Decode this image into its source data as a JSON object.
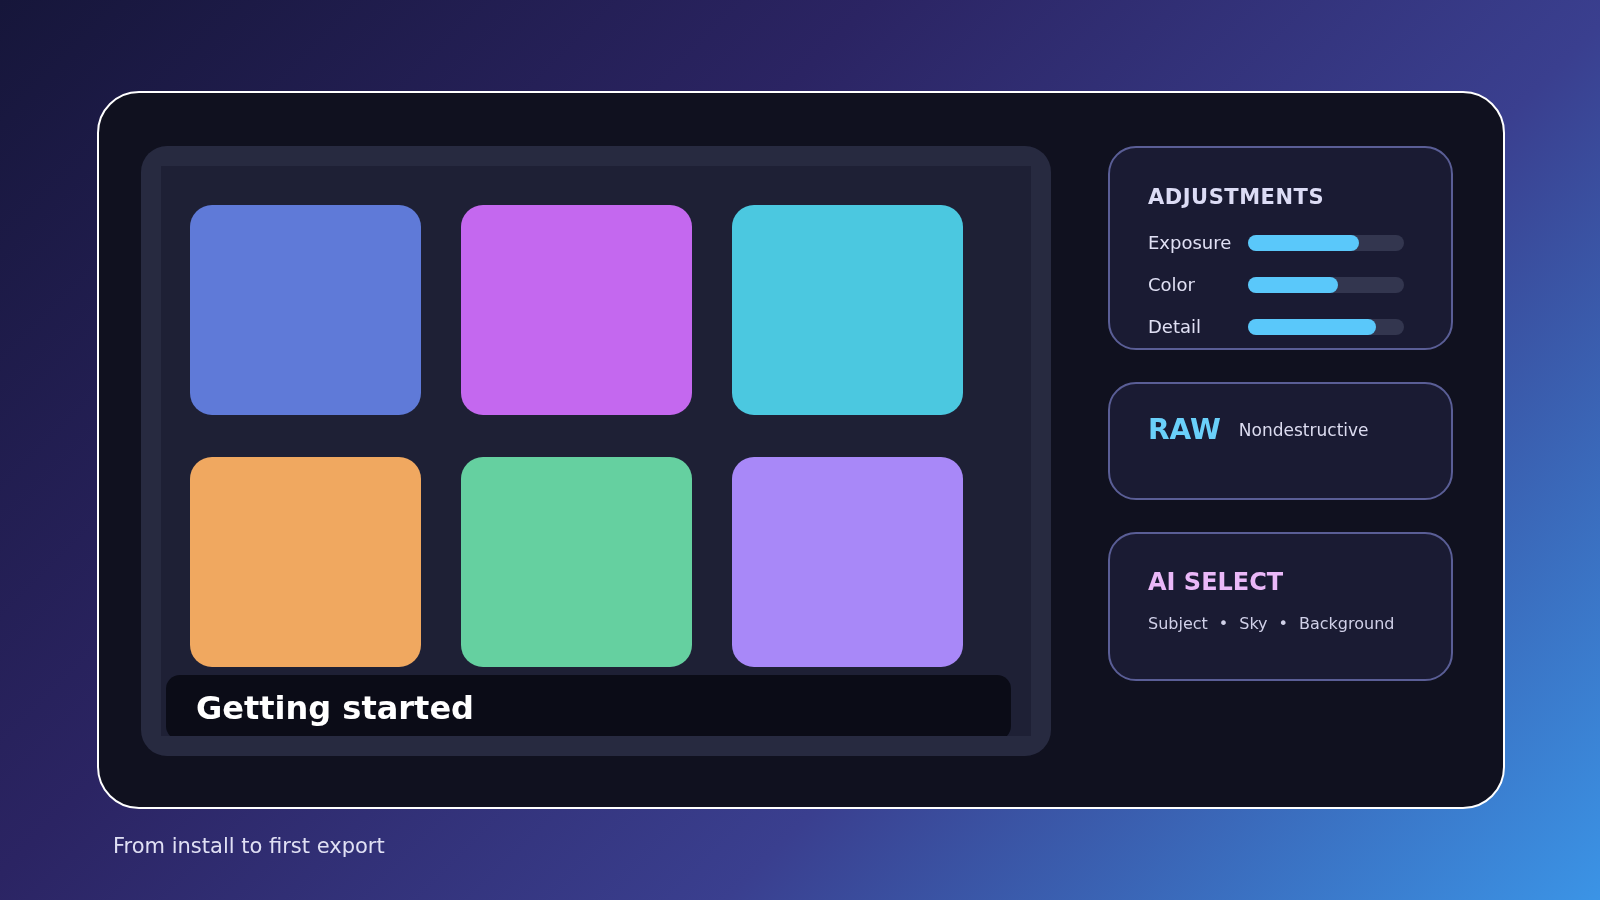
{
  "preview": {
    "tiles": [
      {
        "color": "#5f7ad8"
      },
      {
        "color": "#c468ef"
      },
      {
        "color": "#4bc8e0"
      },
      {
        "color": "#f0a860"
      },
      {
        "color": "#65d0a0"
      },
      {
        "color": "#a888f8"
      }
    ],
    "caption": "Getting started"
  },
  "adjustments": {
    "title": "ADJUSTMENTS",
    "sliders": [
      {
        "label": "Exposure",
        "level": 0.71
      },
      {
        "label": "Color",
        "level": 0.58
      },
      {
        "label": "Detail",
        "level": 0.82
      }
    ]
  },
  "raw": {
    "title": "RAW",
    "subtitle": "Nondestructive"
  },
  "ai_select": {
    "title": "AI SELECT",
    "items": [
      "Subject",
      "Sky",
      "Background"
    ],
    "separator": "•"
  },
  "footer": "From install to first export"
}
